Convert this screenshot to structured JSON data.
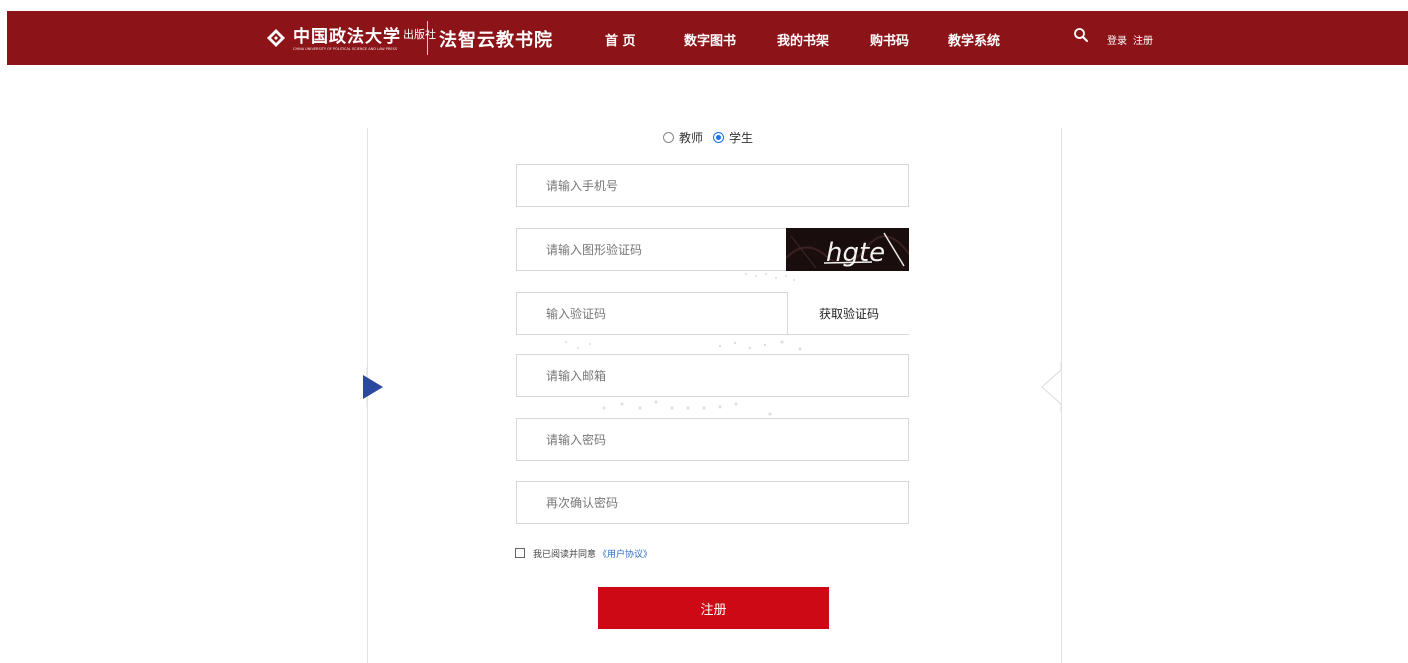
{
  "header": {
    "logo_text": "中国政法大学",
    "logo_press": "出版社",
    "logo_english": "CHINA UNIVERSITY OF POLITICAL SCIENCE AND LAW PRESS",
    "site_name": "法智云教书院",
    "nav": [
      {
        "label": "首 页"
      },
      {
        "label": "数字图书"
      },
      {
        "label": "我的书架"
      },
      {
        "label": "购书码"
      },
      {
        "label": "教学系统"
      }
    ],
    "login": "登录",
    "register": "注册"
  },
  "form": {
    "roles": [
      {
        "label": "教师",
        "checked": false
      },
      {
        "label": "学生",
        "checked": true
      }
    ],
    "phone_placeholder": "请输入手机号",
    "captcha_placeholder": "请输入图形验证码",
    "captcha_text": "hgte",
    "code_placeholder": "输入验证码",
    "get_code_label": "获取验证码",
    "email_placeholder": "请输入邮箱",
    "password_placeholder": "请输入密码",
    "confirm_placeholder": "再次确认密码",
    "agree_text": "我已阅读并同意",
    "agree_link": "《用户协议》",
    "submit_label": "注册"
  },
  "colors": {
    "header_bg": "#8c1418",
    "submit_bg": "#cc0914",
    "radio_accent": "#1a73e8",
    "link": "#2a6cc8",
    "arrow": "#2a4aa0"
  }
}
